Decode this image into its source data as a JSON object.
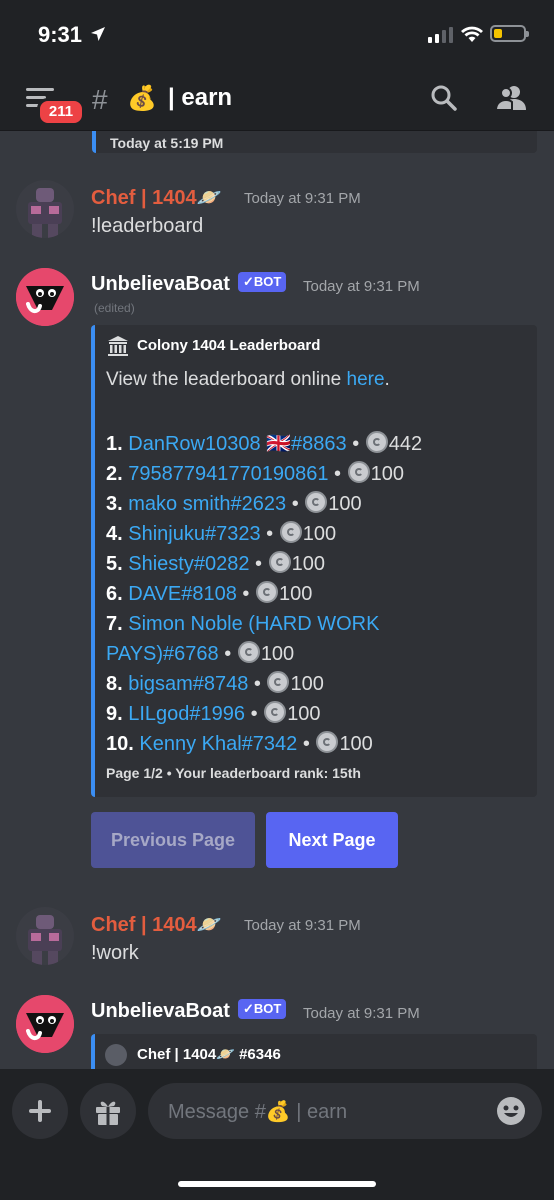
{
  "status": {
    "time": "9:31"
  },
  "header": {
    "badge": "211",
    "channel_emoji": "💰",
    "channel_name": "| earn"
  },
  "previous": {
    "timestamp": "Today at 5:19 PM"
  },
  "messages": [
    {
      "author": "Chef | 1404",
      "author_emoji": "🪐",
      "timestamp": "Today at 9:31 PM",
      "text": "!leaderboard"
    },
    {
      "author": "UnbelievaBoat",
      "bot_tag": "✓BOT",
      "timestamp": "Today at 9:31 PM",
      "edited": "(edited)"
    },
    {
      "author": "Chef | 1404",
      "author_emoji": "🪐",
      "timestamp": "Today at 9:31 PM",
      "text": "!work"
    },
    {
      "author": "UnbelievaBoat",
      "bot_tag": "✓BOT",
      "timestamp": "Today at 9:31 PM"
    }
  ],
  "embed": {
    "author": "Colony 1404 Leaderboard",
    "desc_prefix": "View the leaderboard online ",
    "desc_link": "here",
    "desc_suffix": ".",
    "rows": [
      {
        "rank": "1.",
        "user": "DanRow10308 🇬🇧#8863",
        "amount": "442"
      },
      {
        "rank": "2.",
        "user": "795877941770190861",
        "amount": "100"
      },
      {
        "rank": "3.",
        "user": "mako smith#2623",
        "amount": "100"
      },
      {
        "rank": "4.",
        "user": "Shinjuku#7323",
        "amount": "100"
      },
      {
        "rank": "5.",
        "user": "Shiesty#0282",
        "amount": "100"
      },
      {
        "rank": "6.",
        "user": "DAVE#8108",
        "amount": "100"
      },
      {
        "rank": "7.",
        "user": "Simon Noble (HARD WORK",
        "user2": "PAYS)#6768",
        "amount": "100"
      },
      {
        "rank": "8.",
        "user": "bigsam#8748",
        "amount": "100"
      },
      {
        "rank": "9.",
        "user": "LILgod#1996",
        "amount": "100"
      },
      {
        "rank": "10.",
        "user": "Kenny Khal#7342",
        "amount": "100"
      }
    ],
    "separator": "•",
    "footer": "Page 1/2  •  Your leaderboard rank: 15th"
  },
  "buttons": {
    "prev": "Previous Page",
    "next": "Next Page"
  },
  "embed2": {
    "author": "Chef | 1404🪐 #6346"
  },
  "composer": {
    "placeholder": "Message #💰 | earn"
  }
}
